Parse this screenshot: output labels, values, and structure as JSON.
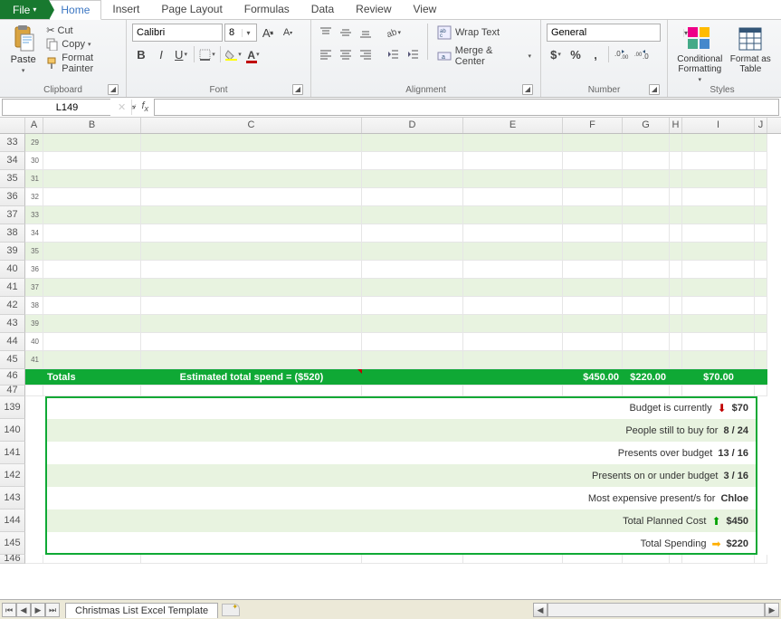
{
  "tabs": {
    "file": "File",
    "home": "Home",
    "insert": "Insert",
    "pagelayout": "Page Layout",
    "formulas": "Formulas",
    "data": "Data",
    "review": "Review",
    "view": "View"
  },
  "ribbon": {
    "clipboard": {
      "paste": "Paste",
      "cut": "Cut",
      "copy": "Copy",
      "painter": "Format Painter",
      "label": "Clipboard"
    },
    "font": {
      "name": "Calibri",
      "size": "8",
      "label": "Font"
    },
    "alignment": {
      "wrap": "Wrap Text",
      "merge": "Merge & Center",
      "label": "Alignment"
    },
    "number": {
      "format": "General",
      "label": "Number"
    },
    "styles": {
      "cond": "Conditional Formatting",
      "fmttbl": "Format as Table",
      "label": "Styles"
    }
  },
  "namebox": "L149",
  "columns": [
    "A",
    "B",
    "C",
    "D",
    "E",
    "F",
    "G",
    "H",
    "I",
    "J"
  ],
  "seq_rows": [
    {
      "rn": "33",
      "seq": "29"
    },
    {
      "rn": "34",
      "seq": "30"
    },
    {
      "rn": "35",
      "seq": "31"
    },
    {
      "rn": "36",
      "seq": "32"
    },
    {
      "rn": "37",
      "seq": "33"
    },
    {
      "rn": "38",
      "seq": "34"
    },
    {
      "rn": "39",
      "seq": "35"
    },
    {
      "rn": "40",
      "seq": "36"
    },
    {
      "rn": "41",
      "seq": "37"
    },
    {
      "rn": "42",
      "seq": "38"
    },
    {
      "rn": "43",
      "seq": "39"
    },
    {
      "rn": "44",
      "seq": "40"
    },
    {
      "rn": "45",
      "seq": "41"
    }
  ],
  "totals": {
    "rn": "46",
    "label": "Totals",
    "estimate": "Estimated total spend = ($520)",
    "f": "$450.00",
    "g": "$220.00",
    "i": "$70.00"
  },
  "blank_rn": "47",
  "summary": [
    {
      "rn": "139",
      "label": "Budget is currently",
      "icon": "down",
      "value": "$70",
      "alt": false
    },
    {
      "rn": "140",
      "label": "People still to buy for",
      "icon": "",
      "value": "8 / 24",
      "alt": true
    },
    {
      "rn": "141",
      "label": "Presents over budget",
      "icon": "",
      "value": "13 / 16",
      "alt": false
    },
    {
      "rn": "142",
      "label": "Presents on or under budget",
      "icon": "",
      "value": "3 / 16",
      "alt": true
    },
    {
      "rn": "143",
      "label": "Most expensive present/s for",
      "icon": "",
      "value": "Chloe",
      "alt": false
    },
    {
      "rn": "144",
      "label": "Total Planned Cost",
      "icon": "up",
      "value": "$450",
      "alt": true
    },
    {
      "rn": "145",
      "label": "Total Spending",
      "icon": "right",
      "value": "$220",
      "alt": false
    }
  ],
  "end_rn": "146",
  "sheet": {
    "name": "Christmas List Excel Template"
  }
}
